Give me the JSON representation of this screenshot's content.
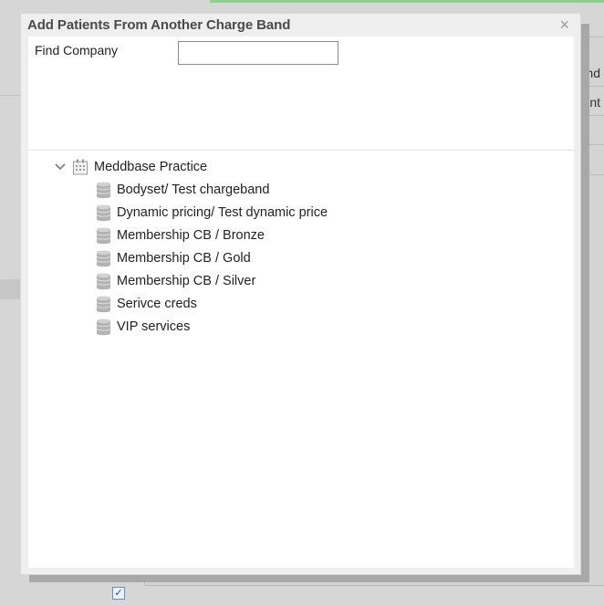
{
  "background": {
    "right_snippets": [
      "and",
      "ent"
    ],
    "checkbox_checked": true
  },
  "dialog": {
    "title": "Add Patients From Another Charge Band",
    "close_glyph": "×",
    "find": {
      "label": "Find Company",
      "value": "",
      "placeholder": ""
    },
    "tree": {
      "root": {
        "label": "Meddbase Practice",
        "icon": "building-icon",
        "expanded": true,
        "children": [
          {
            "label": "Bodyset/ Test chargeband",
            "icon": "database-icon"
          },
          {
            "label": "Dynamic pricing/ Test dynamic price",
            "icon": "database-icon"
          },
          {
            "label": "Membership CB / Bronze",
            "icon": "database-icon"
          },
          {
            "label": "Membership CB / Gold",
            "icon": "database-icon"
          },
          {
            "label": "Membership CB / Silver",
            "icon": "database-icon"
          },
          {
            "label": "Serivce creds",
            "icon": "database-icon"
          },
          {
            "label": "VIP services",
            "icon": "database-icon"
          }
        ]
      }
    }
  },
  "colors": {
    "overlay_bg": "#d6d6d6",
    "dialog_bg": "#efefef",
    "icon_gray": "#a9a9a9",
    "top_accent": "#8fd18a"
  }
}
